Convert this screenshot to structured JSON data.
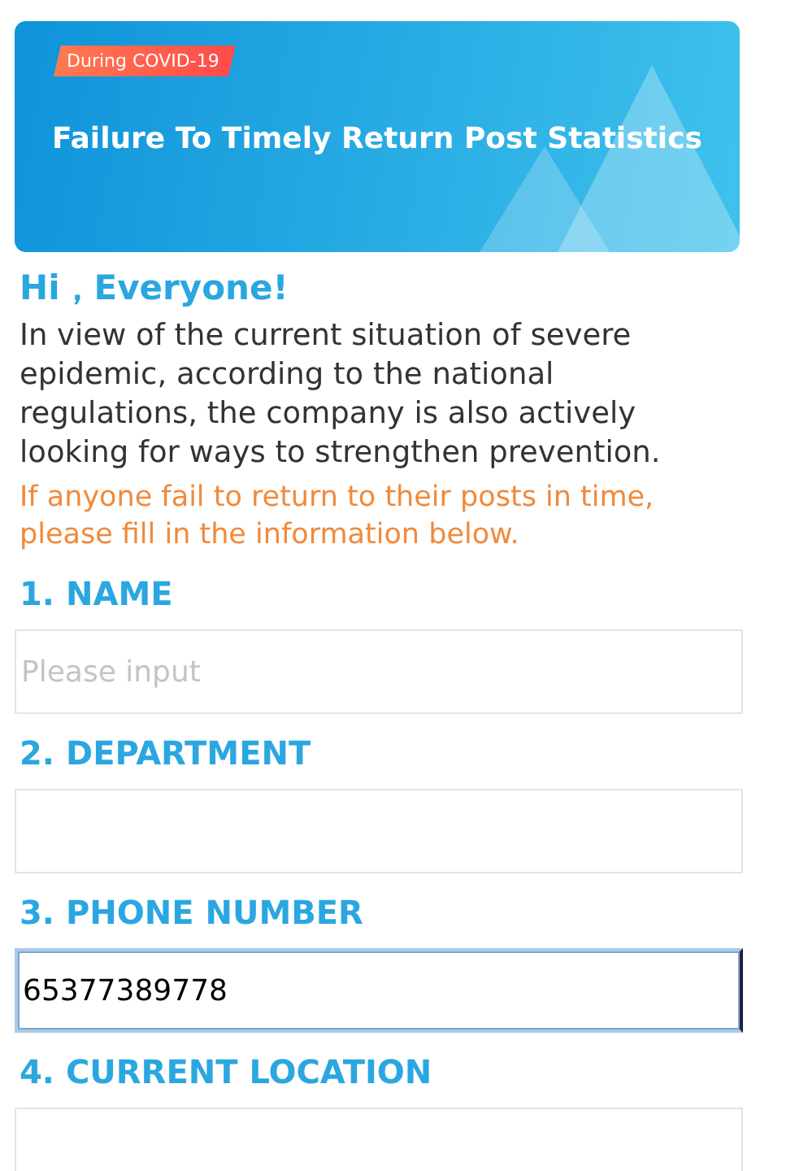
{
  "banner": {
    "tag": "During COVID-19",
    "title": "Failure To Timely Return Post Statistics"
  },
  "greeting": "Hi，Everyone!",
  "intro": "In view of the current situation of severe epidemic, according to the national regulations, the company is also actively looking for ways to strengthen prevention.",
  "notice": "If anyone fail to return to their posts in time, please fill in the information below.",
  "fields": [
    {
      "label": "1. NAME",
      "placeholder": "Please input",
      "focused": false
    },
    {
      "label": "2. DEPARTMENT",
      "focused": false
    },
    {
      "label": "3. PHONE NUMBER",
      "value": "65377389778",
      "focused": true
    },
    {
      "label": "4. CURRENT LOCATION",
      "focused": false
    }
  ]
}
